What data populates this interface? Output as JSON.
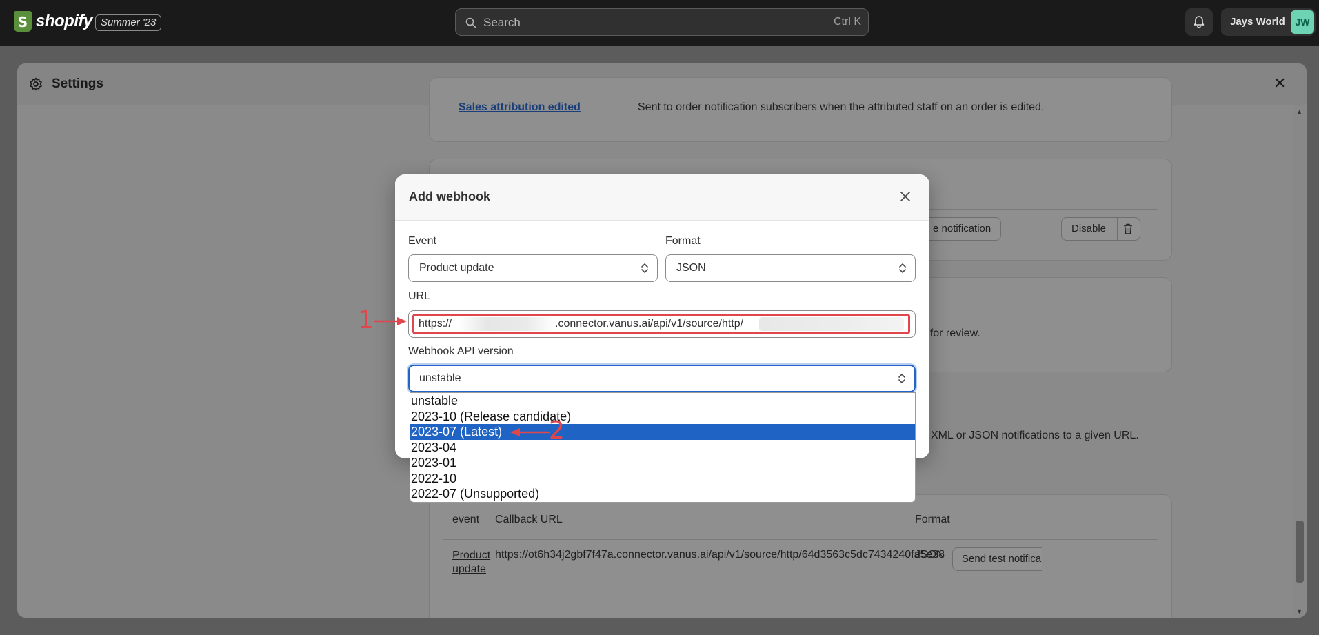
{
  "topbar": {
    "logo_text": "shopify",
    "edition_badge": "Summer '23",
    "search_placeholder": "Search",
    "search_shortcut": "Ctrl K",
    "store_name": "Jays World",
    "avatar_initials": "JW"
  },
  "settings": {
    "title": "Settings"
  },
  "background": {
    "sales_attribution_link": "Sales attribution edited",
    "sales_attribution_desc": "Sent to order notification subscribers when the attributed staff on an order is edited.",
    "send_notification_btn": "e notification",
    "disable_btn": "Disable",
    "review_text": "r for review.",
    "webhooks_desc": "XML or JSON notifications to a given URL.",
    "table": {
      "headers": [
        "event",
        "Callback URL",
        "Format"
      ],
      "row": {
        "event": "Product update",
        "callback_url": "https://ot6h34j2gbf7f47a.connector.vanus.ai/api/v1/source/http/64d3563c5dc7434240fa5e38",
        "format": "JSON",
        "action": "Send test notifica"
      }
    }
  },
  "modal": {
    "title": "Add webhook",
    "event_label": "Event",
    "event_value": "Product update",
    "format_label": "Format",
    "format_value": "JSON",
    "url_label": "URL",
    "url_prefix": "https://",
    "url_middle": ".connector.vanus.ai/api/v1/source/http/",
    "api_version_label": "Webhook API version",
    "api_version_value": "unstable"
  },
  "dropdown": {
    "options": [
      "unstable",
      "2023-10 (Release candidate)",
      "2023-07 (Latest)",
      "2023-04",
      "2023-01",
      "2022-10",
      "2022-07 (Unsupported)"
    ],
    "selected_index": 2
  },
  "annotations": {
    "marker_1": "1",
    "marker_2": "2"
  },
  "colors": {
    "annotation": "#e0474c",
    "selection": "#1f63c4",
    "focus": "#2463c7"
  }
}
